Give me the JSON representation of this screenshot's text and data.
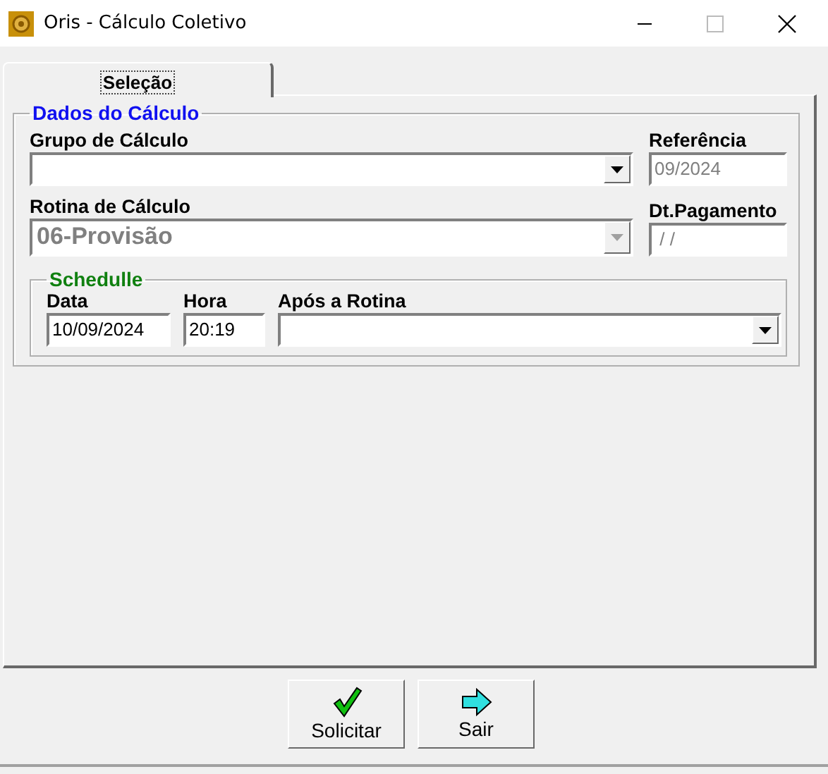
{
  "window": {
    "title": "Oris - Cálculo Coletivo"
  },
  "tabs": [
    {
      "label": "Seleção",
      "selected": true
    }
  ],
  "dados": {
    "title": "Dados do Cálculo",
    "grupo": {
      "label": "Grupo de Cálculo",
      "disabled": false
    },
    "referencia": {
      "label": "Referência",
      "value": "09/2024",
      "disabled": true
    },
    "rotina": {
      "label": "Rotina de Cálculo",
      "value": "06-Provisão",
      "disabled": true
    },
    "pagamento": {
      "label": "Dt.Pagamento",
      "value": " / /",
      "disabled": true
    }
  },
  "schedule": {
    "title": "Schedulle",
    "data": {
      "label": "Data",
      "value": "10/09/2024"
    },
    "hora": {
      "label": "Hora",
      "value": "20:19"
    },
    "apos": {
      "label": "Após a Rotina"
    }
  },
  "buttons": [
    {
      "label": "Solicitar",
      "kind": "check"
    },
    {
      "label": "Sair",
      "kind": "arrow"
    }
  ]
}
